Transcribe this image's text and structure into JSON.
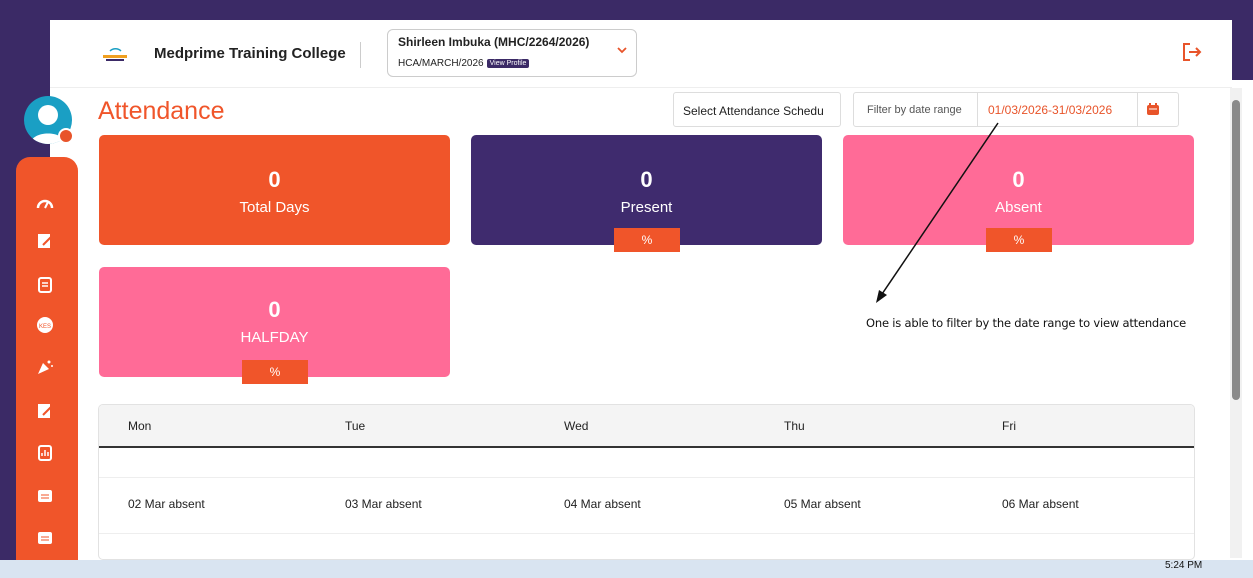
{
  "header": {
    "college_name": "Medprime Training College",
    "student_name": "Shirleen Imbuka (MHC/2264/2026)",
    "student_batch": "HCA/MARCH/2026",
    "view_profile_label": "View Profile"
  },
  "page": {
    "title": "Attendance"
  },
  "filters": {
    "schedule_select": "Select Attendance Schedu",
    "date_range_label": "Filter by date range",
    "date_range_value": "01/03/2026-31/03/2026"
  },
  "stats": {
    "total_days": {
      "value": "0",
      "label": "Total Days"
    },
    "present": {
      "value": "0",
      "label": "Present",
      "pct": "%"
    },
    "absent": {
      "value": "0",
      "label": "Absent",
      "pct": "%"
    },
    "halfday": {
      "value": "0",
      "label": "HALFDAY",
      "pct": "%"
    }
  },
  "annotation": "One is able to filter by the date range to view attendance",
  "calendar": {
    "days": [
      "Mon",
      "Tue",
      "Wed",
      "Thu",
      "Fri"
    ],
    "row1": [
      "02 Mar absent",
      "03 Mar absent",
      "04 Mar absent",
      "05 Mar absent",
      "06 Mar absent"
    ]
  },
  "taskbar": {
    "clock": "5:24 PM"
  },
  "colors": {
    "accent": "#f0552a",
    "purple": "#3b2a66",
    "pink": "#ff6b97"
  }
}
